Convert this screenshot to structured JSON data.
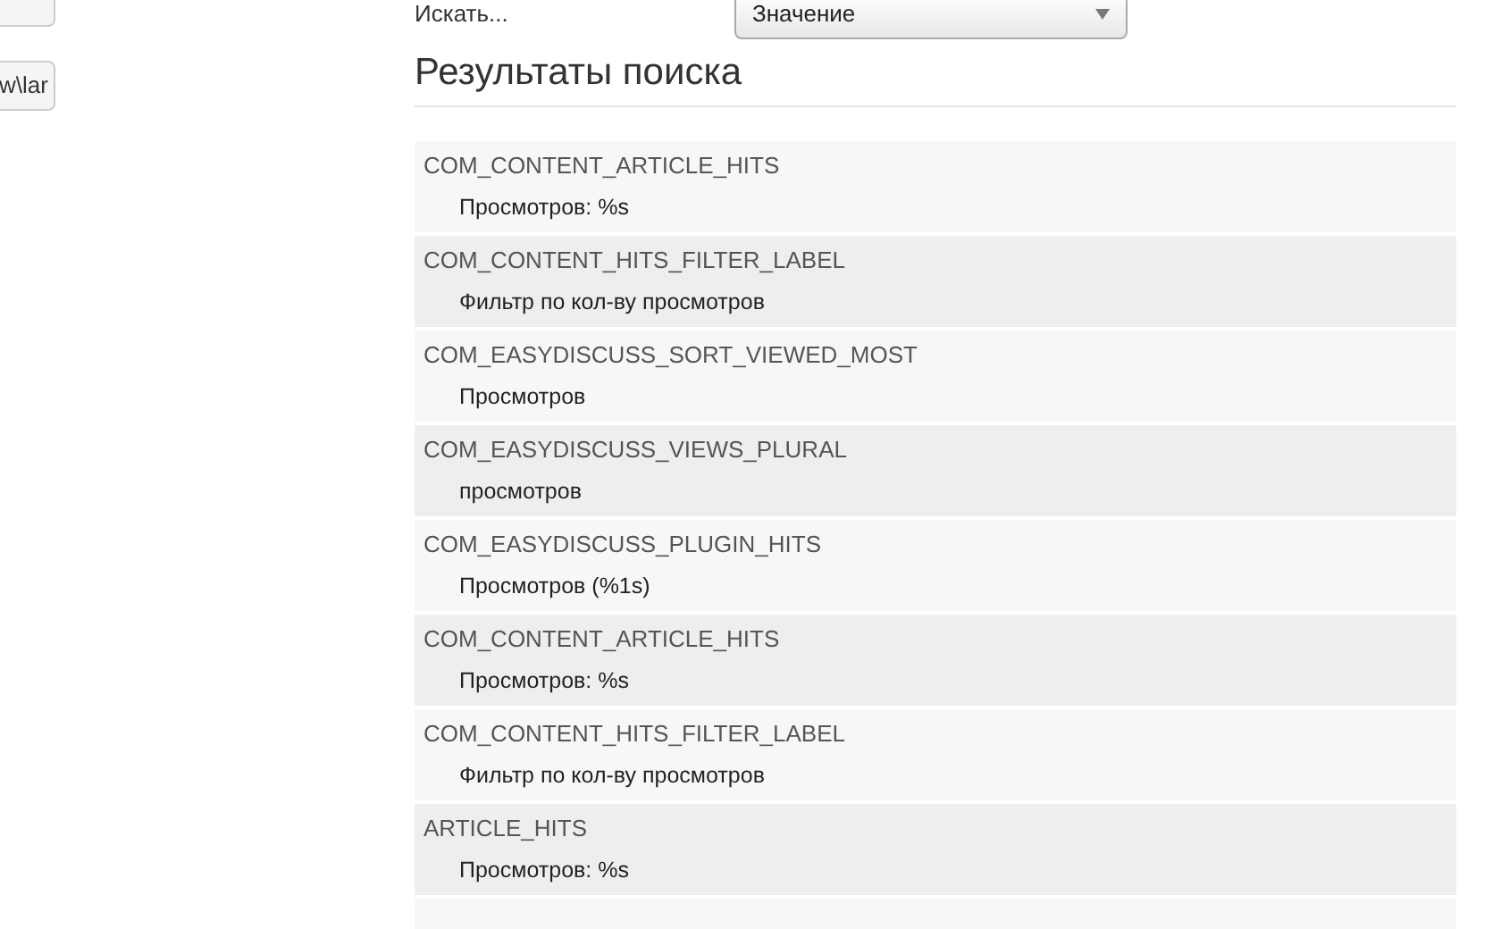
{
  "side_buttons": [
    {
      "label": "w\\lar"
    }
  ],
  "search": {
    "label": "Искать...",
    "select_value": "Значение"
  },
  "results": {
    "title": "Результаты поиска",
    "rows": [
      {
        "key": "COM_CONTENT_ARTICLE_HITS",
        "value": "Просмотров: %s"
      },
      {
        "key": "COM_CONTENT_HITS_FILTER_LABEL",
        "value": "Фильтр по кол-ву просмотров"
      },
      {
        "key": "COM_EASYDISCUSS_SORT_VIEWED_MOST",
        "value": "Просмотров"
      },
      {
        "key": "COM_EASYDISCUSS_VIEWS_PLURAL",
        "value": "просмотров"
      },
      {
        "key": "COM_EASYDISCUSS_PLUGIN_HITS",
        "value": "Просмотров (%1s)"
      },
      {
        "key": "COM_CONTENT_ARTICLE_HITS",
        "value": "Просмотров: %s"
      },
      {
        "key": "COM_CONTENT_HITS_FILTER_LABEL",
        "value": "Фильтр по кол-ву просмотров"
      },
      {
        "key": "ARTICLE_HITS",
        "value": "Просмотров: %s"
      }
    ]
  }
}
